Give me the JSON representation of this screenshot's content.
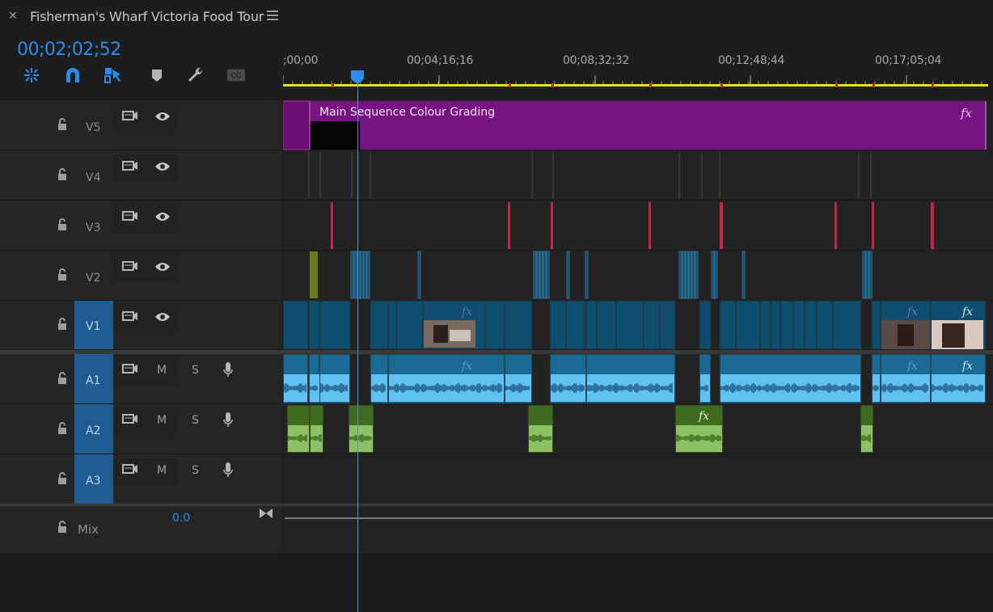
{
  "panel": {
    "title": "Fisherman's Wharf Victoria Food Tour",
    "close_icon": "close-icon",
    "menu_icon": "hamburger-menu-icon",
    "timecode": "00;02;02;52"
  },
  "colors": {
    "timecode": "#2d8ceb",
    "video_clip": "#0e4d6e",
    "audio_clip": "#1a6a93",
    "audio_wave": "#62c1f3",
    "a2_clip": "#3e6b1e",
    "a2_wave": "#8cc265",
    "grading": "#781482",
    "marker": "#c8234b",
    "target": "#1e5c91",
    "ruler_bar": "#e8e019"
  },
  "toolbar": {
    "tools": [
      "nest-icon",
      "snap-magnet-icon",
      "linked-selection-icon",
      "add-marker-icon",
      "settings-wrench-icon",
      "captions-icon"
    ],
    "captions_label": "CC"
  },
  "ruler": {
    "labels": [
      ";00;00",
      "00;04;16;16",
      "00;08;32;32",
      "00;12;48;44",
      "00;17;05;04"
    ]
  },
  "tracks": {
    "v5": {
      "name": "V5"
    },
    "v4": {
      "name": "V4"
    },
    "v3": {
      "name": "V3"
    },
    "v2": {
      "name": "V2"
    },
    "v1": {
      "name": "V1"
    },
    "a1": {
      "name": "A1",
      "mute": "M",
      "solo": "S"
    },
    "a2": {
      "name": "A2",
      "mute": "M",
      "solo": "S"
    },
    "a3": {
      "name": "A3",
      "mute": "M",
      "solo": "S"
    },
    "mix": {
      "name": "Mix",
      "value": "0.0"
    }
  },
  "clips": {
    "grading_label": "Main Sequence Colour Grading",
    "fx_label": "fx"
  }
}
